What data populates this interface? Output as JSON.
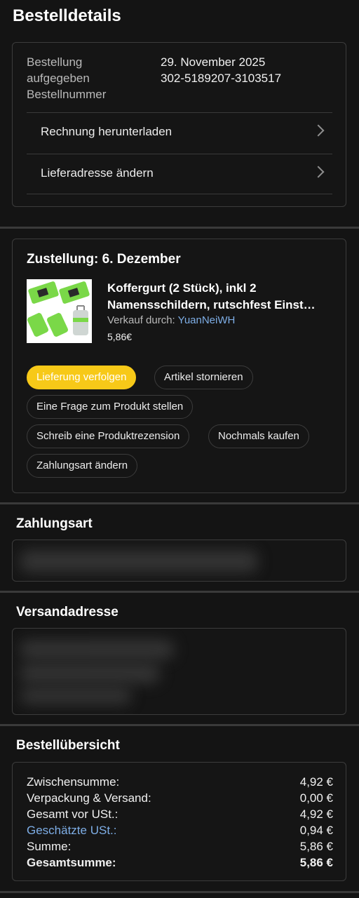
{
  "page": {
    "title": "Bestelldetails"
  },
  "order": {
    "label_placed": "Bestellung aufgegeben",
    "label_placed_line1": "Bestellung",
    "label_placed_line2": "aufgegeben",
    "label_number": "Bestellnummer",
    "date": "29. November 2025",
    "number": "302-5189207-3103517",
    "links": [
      {
        "label": "Rechnung herunterladen",
        "icon": "chevron-right-icon"
      },
      {
        "label": "Lieferadresse ändern",
        "icon": "chevron-right-icon"
      }
    ]
  },
  "delivery": {
    "heading": "Zustellung: 6. Dezember",
    "product": {
      "title_line1": "Koffergurt (2 Stück), inkl 2",
      "title_line2": "Namensschildern, rutschfest Einst…",
      "seller_label": "Verkauf durch:",
      "seller_name": "YuanNeiWH",
      "price": "5,86€"
    },
    "actions": [
      "Lieferung verfolgen",
      "Artikel stornieren",
      "Eine Frage zum Produkt stellen",
      "Schreib eine Produktrezension",
      "Nochmals kaufen",
      "Zahlungsart ändern"
    ]
  },
  "payment": {
    "heading": "Zahlungsart"
  },
  "shipping": {
    "heading": "Versandadresse"
  },
  "summary": {
    "heading": "Bestellübersicht",
    "rows": [
      {
        "label": "Zwischensumme:",
        "amount": "4,92 €"
      },
      {
        "label": "Verpackung & Versand:",
        "amount": "0,00 €"
      },
      {
        "label": "Gesamt vor USt.:",
        "amount": "4,92 €"
      },
      {
        "label": "Geschätzte USt.:",
        "amount": "0,94 €"
      },
      {
        "label": "Summe:",
        "amount": "5,86 €"
      },
      {
        "label": "Gesamtsumme:",
        "amount": "5,86 €"
      }
    ]
  },
  "colors": {
    "background": "#141414",
    "accent_yellow": "#f7c918",
    "link_blue": "#7eaee6",
    "product_green": "#7ad848"
  }
}
